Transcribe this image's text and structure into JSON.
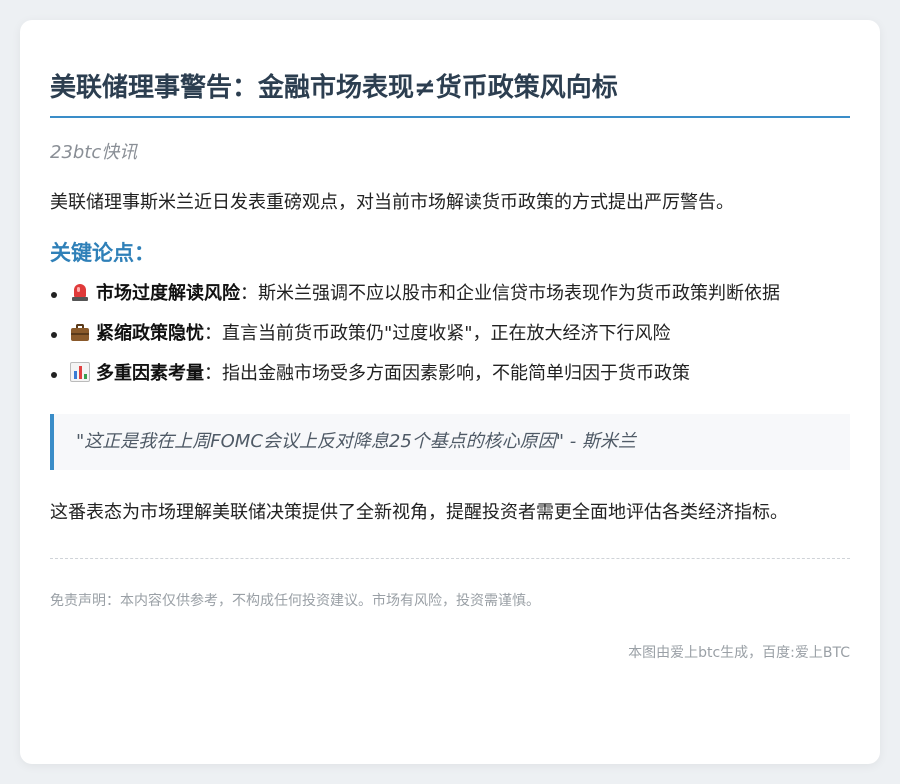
{
  "article": {
    "title": "美联储理事警告：金融市场表现≠货币政策风向标",
    "source": "23btc快讯",
    "intro": "美联储理事斯米兰近日发表重磅观点，对当前市场解读货币政策的方式提出严厉警告。",
    "section_heading": "关键论点：",
    "points": [
      {
        "icon": "siren-icon",
        "label": "市场过度解读风险",
        "separator": "：",
        "text": "斯米兰强调不应以股市和企业信贷市场表现作为货币政策判断依据"
      },
      {
        "icon": "briefcase-icon",
        "label": "紧缩政策隐忧",
        "separator": "：",
        "text": "直言当前货币政策仍\"过度收紧\"，正在放大经济下行风险"
      },
      {
        "icon": "bar-chart-icon",
        "label": "多重因素考量",
        "separator": "：",
        "text": "指出金融市场受多方面因素影响，不能简单归因于货币政策"
      }
    ],
    "quote": "\"这正是我在上周FOMC会议上反对降息25个基点的核心原因\" - 斯米兰",
    "conclusion": "这番表态为市场理解美联储决策提供了全新视角，提醒投资者需更全面地评估各类经济指标。",
    "disclaimer": "免责声明：本内容仅供参考，不构成任何投资建议。市场有风险，投资需谨慎。",
    "credit": "本图由爱上btc生成，百度:爱上BTC"
  },
  "colors": {
    "accent": "#3a8dc8",
    "heading": "#2f80b8",
    "title": "#2c3e50",
    "muted": "#9aa0a6"
  }
}
